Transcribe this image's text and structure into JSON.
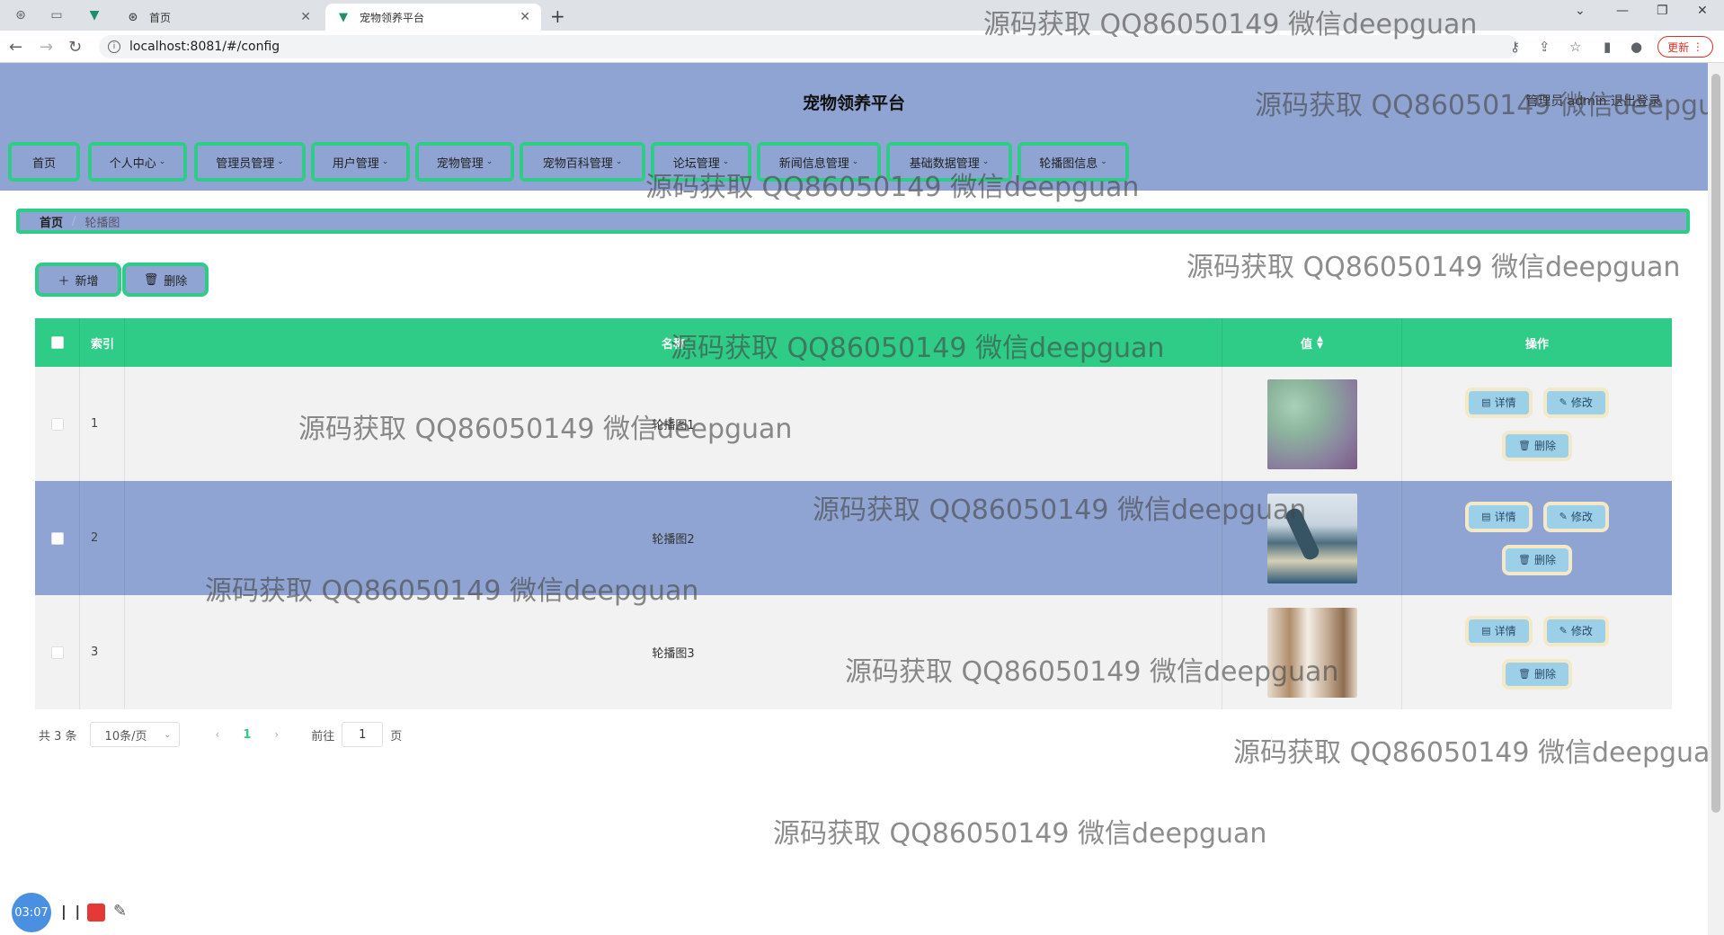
{
  "browser": {
    "tabs": [
      {
        "title": "首页",
        "active": false
      },
      {
        "title": "宠物领养平台",
        "active": true
      }
    ],
    "url": "localhost:8081/#/config",
    "update_label": "更新"
  },
  "header": {
    "title": "宠物领养平台",
    "user_info": "管理员 admin   退出登录"
  },
  "menu": [
    {
      "label": "首页",
      "has_dropdown": false
    },
    {
      "label": "个人中心",
      "has_dropdown": true
    },
    {
      "label": "管理员管理",
      "has_dropdown": true
    },
    {
      "label": "用户管理",
      "has_dropdown": true
    },
    {
      "label": "宠物管理",
      "has_dropdown": true
    },
    {
      "label": "宠物百科管理",
      "has_dropdown": true
    },
    {
      "label": "论坛管理",
      "has_dropdown": true
    },
    {
      "label": "新闻信息管理",
      "has_dropdown": true
    },
    {
      "label": "基础数据管理",
      "has_dropdown": true
    },
    {
      "label": "轮播图信息",
      "has_dropdown": true
    }
  ],
  "breadcrumb": {
    "home": "首页",
    "current": "轮播图"
  },
  "actions": {
    "add_label": "新增",
    "delete_label": "删除"
  },
  "table": {
    "columns": {
      "index": "索引",
      "name": "名称",
      "value": "值",
      "ops": "操作"
    },
    "rows": [
      {
        "index": "1",
        "name": "轮播图1",
        "image": "abstract-gradient"
      },
      {
        "index": "2",
        "name": "轮播图2",
        "image": "dolphin-sea"
      },
      {
        "index": "3",
        "name": "轮播图3",
        "image": "interior-room"
      }
    ],
    "op_labels": {
      "detail": "详情",
      "edit": "修改",
      "delete": "删除"
    }
  },
  "pagination": {
    "total": "共 3 条",
    "page_size": "10条/页",
    "current_page": "1",
    "goto_prefix": "前往",
    "goto_value": "1",
    "goto_suffix": "页"
  },
  "watermark": "源码获取 QQ86050149 微信deepguan",
  "recorder": {
    "time": "03:07"
  },
  "colors": {
    "accent_green": "#2ecc87",
    "header_blue": "#8fa4d2",
    "op_button": "#9cd0e8"
  }
}
